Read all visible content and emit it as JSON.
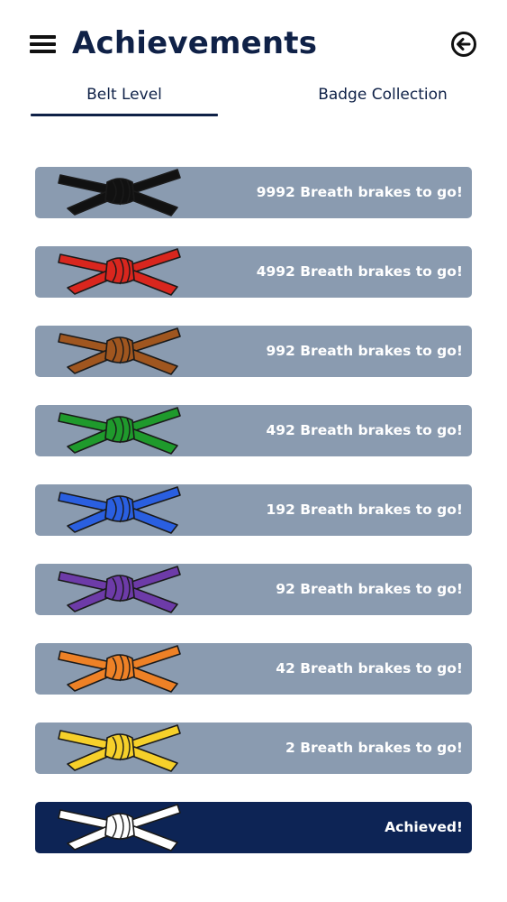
{
  "header": {
    "title": "Achievements"
  },
  "tabs": [
    {
      "label": "Belt Level",
      "active": true
    },
    {
      "label": "Badge Collection",
      "active": false
    }
  ],
  "colors": {
    "accent": "#0f2147",
    "card_bg": "#8a9bb0",
    "achieved_bg": "#0d2455"
  },
  "belts": [
    {
      "color": "#111111",
      "status": "9992 Breath brakes to go!",
      "achieved": false
    },
    {
      "color": "#d9261e",
      "status": "4992 Breath brakes to go!",
      "achieved": false
    },
    {
      "color": "#a0561f",
      "status": "992 Breath brakes to go!",
      "achieved": false
    },
    {
      "color": "#1f9a2c",
      "status": "492 Breath brakes to go!",
      "achieved": false
    },
    {
      "color": "#2a5fe0",
      "status": "192 Breath brakes to go!",
      "achieved": false
    },
    {
      "color": "#6d3ba8",
      "status": "92 Breath brakes to go!",
      "achieved": false
    },
    {
      "color": "#ee8126",
      "status": "42 Breath brakes to go!",
      "achieved": false
    },
    {
      "color": "#f6d02a",
      "status": "2 Breath brakes to go!",
      "achieved": false
    },
    {
      "color": "#ffffff",
      "status": "Achieved!",
      "achieved": true
    }
  ]
}
